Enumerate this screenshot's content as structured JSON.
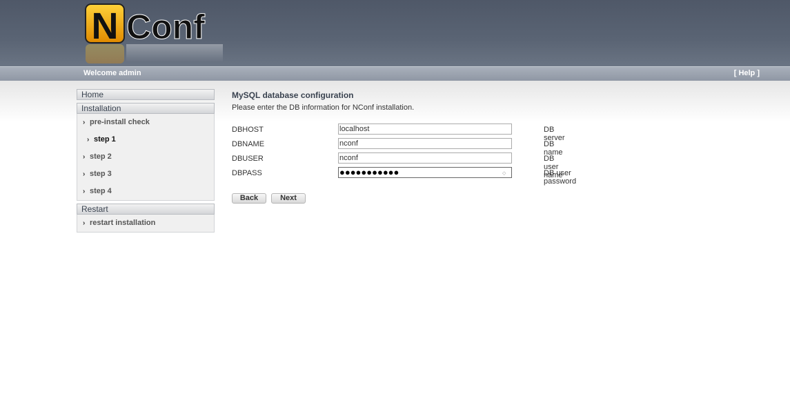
{
  "header": {
    "welcome": "Welcome admin",
    "help": "[ Help ]"
  },
  "logo": {
    "text_n": "N",
    "text_conf": "Conf"
  },
  "sidebar": {
    "home": "Home",
    "installation": "Installation",
    "installation_items": [
      {
        "label": "pre-install check"
      },
      {
        "label": "step 1",
        "active": true
      },
      {
        "label": "step 2"
      },
      {
        "label": "step 3"
      },
      {
        "label": "step 4"
      }
    ],
    "restart": "Restart",
    "restart_items": [
      {
        "label": "restart installation"
      }
    ]
  },
  "main": {
    "title": "MySQL database configuration",
    "description": "Please enter the DB information for NConf installation.",
    "fields": [
      {
        "label": "DBHOST",
        "value": "localhost",
        "hint": "DB server"
      },
      {
        "label": "DBNAME",
        "value": "nconf",
        "hint": "DB name"
      },
      {
        "label": "DBUSER",
        "value": "nconf",
        "hint": "DB user name"
      },
      {
        "label": "DBPASS",
        "value": "●●●●●●●●●●●",
        "hint": "DB user password"
      }
    ],
    "back_label": "Back",
    "next_label": "Next"
  }
}
